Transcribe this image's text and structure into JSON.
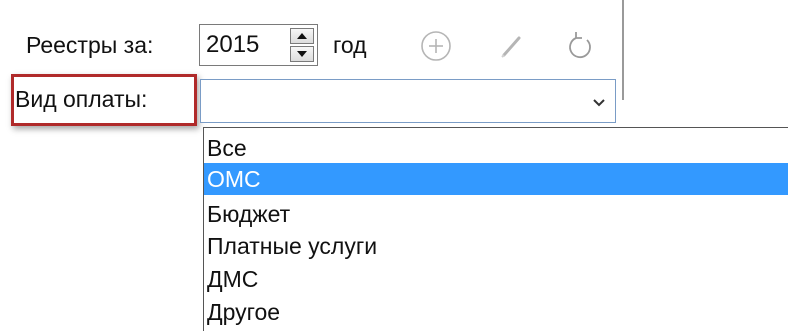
{
  "toolbar": {
    "registers_label": "Реестры за:",
    "year_value": "2015",
    "year_suffix": "год",
    "add_icon": "plus-circle-icon",
    "edit_icon": "pencil-icon",
    "refresh_icon": "refresh-icon"
  },
  "filter": {
    "payment_label": "Вид оплаты:",
    "selected_value": ""
  },
  "dropdown": {
    "options": [
      "Все",
      "ОМС",
      "Бюджет",
      "Платные услуги",
      "ДМС",
      "Другое"
    ],
    "highlighted_option": "ОМС"
  },
  "colors": {
    "highlight_border": "#b02a2a",
    "selection_bg": "#3399ff",
    "selection_text": "#ffffff"
  }
}
